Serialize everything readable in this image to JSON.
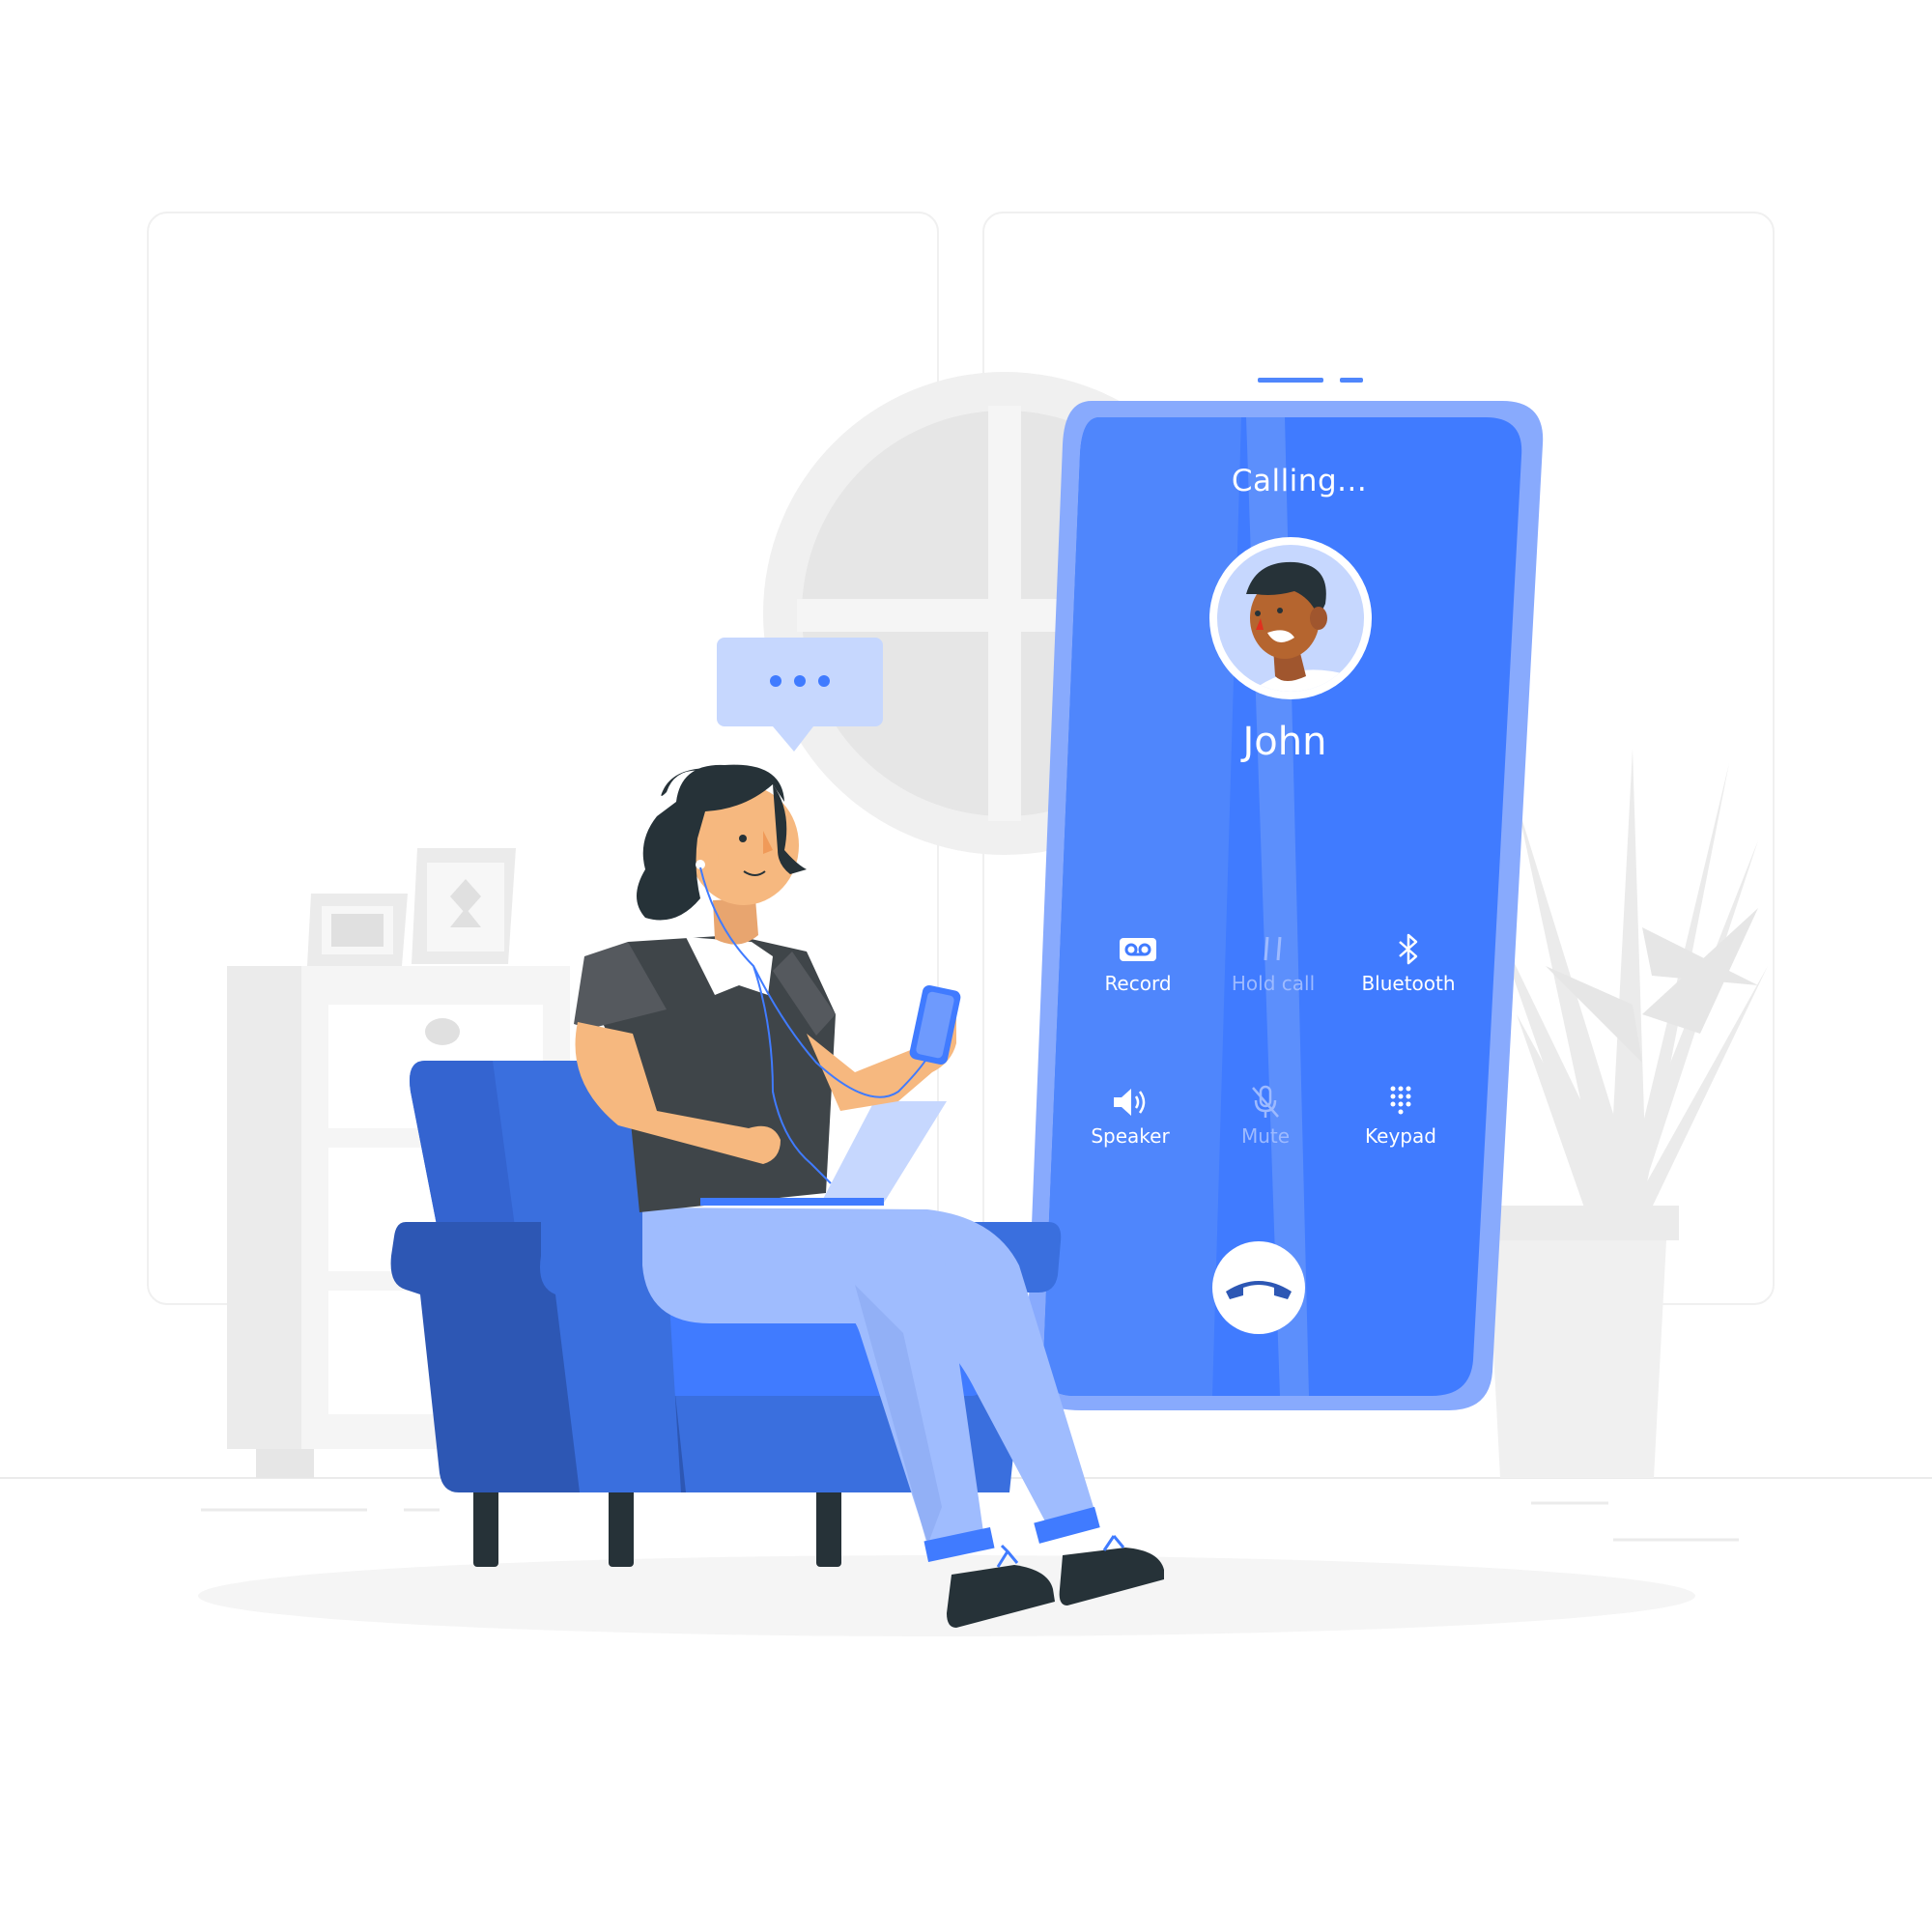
{
  "call": {
    "status": "Calling...",
    "caller_name": "John"
  },
  "controls": [
    {
      "label": "Record",
      "icon": "voicemail-icon",
      "enabled": true
    },
    {
      "label": "Hold call",
      "icon": "pause-icon",
      "enabled": false
    },
    {
      "label": "Bluetooth",
      "icon": "bluetooth-icon",
      "enabled": true
    },
    {
      "label": "Speaker",
      "icon": "speaker-icon",
      "enabled": true
    },
    {
      "label": "Mute",
      "icon": "mic-off-icon",
      "enabled": false
    },
    {
      "label": "Keypad",
      "icon": "keypad-icon",
      "enabled": true
    }
  ],
  "end_call": {
    "icon": "end-call-icon"
  },
  "colors": {
    "phone_body": "#4f86fc",
    "phone_screen": "#407bff",
    "phone_frame": "#88aafd",
    "armchair": "#3a6fde",
    "armchair_dark": "#2d57b4",
    "jeans": "#9fbcfe",
    "shirt": "#3f4549",
    "skin": "#f6b87f",
    "hair": "#263238",
    "background_shapes": "#ebebeb"
  }
}
